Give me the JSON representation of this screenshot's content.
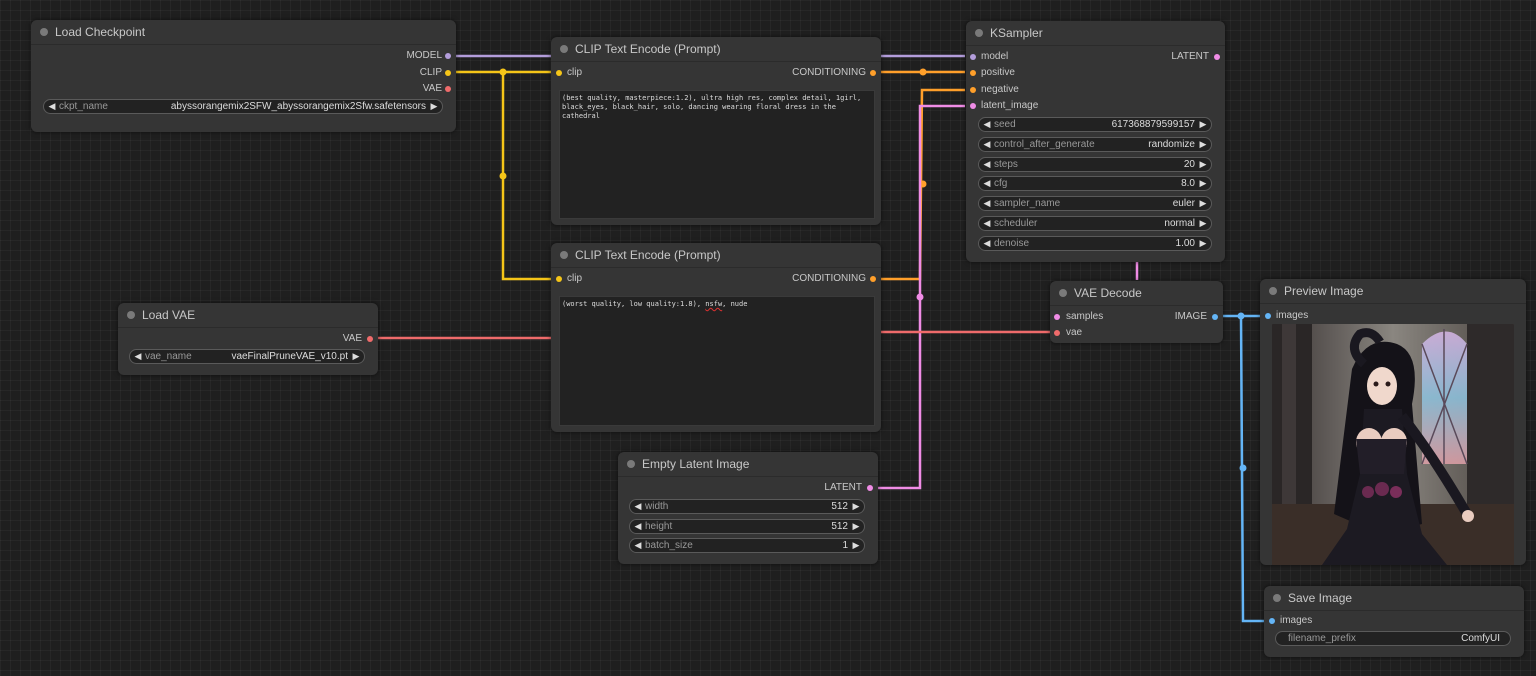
{
  "nodes": {
    "load_checkpoint": {
      "title": "Load Checkpoint",
      "outputs": [
        "MODEL",
        "CLIP",
        "VAE"
      ],
      "widget_label": "ckpt_name",
      "widget_value": "abyssorangemix2SFW_abyssorangemix2Sfw.safetensors"
    },
    "clip_pos": {
      "title": "CLIP Text Encode (Prompt)",
      "input": "clip",
      "output": "CONDITIONING",
      "text": "(best quality, masterpiece:1.2), ultra high res, complex detail, 1girl, black_eyes, black_hair, solo, dancing wearing floral dress in the cathedral"
    },
    "clip_neg": {
      "title": "CLIP Text Encode (Prompt)",
      "input": "clip",
      "output": "CONDITIONING",
      "text_before": "(worst quality, low quality:1.8), ",
      "text_flagged": "nsfw",
      "text_after": ", nude"
    },
    "load_vae": {
      "title": "Load VAE",
      "output": "VAE",
      "widget_label": "vae_name",
      "widget_value": "vaeFinalPruneVAE_v10.pt"
    },
    "empty_latent": {
      "title": "Empty Latent Image",
      "output": "LATENT",
      "widgets": [
        {
          "label": "width",
          "value": "512"
        },
        {
          "label": "height",
          "value": "512"
        },
        {
          "label": "batch_size",
          "value": "1"
        }
      ]
    },
    "ksampler": {
      "title": "KSampler",
      "inputs": [
        "model",
        "positive",
        "negative",
        "latent_image"
      ],
      "output": "LATENT",
      "widgets": [
        {
          "label": "seed",
          "value": "617368879599157"
        },
        {
          "label": "control_after_generate",
          "value": "randomize"
        },
        {
          "label": "steps",
          "value": "20"
        },
        {
          "label": "cfg",
          "value": "8.0"
        },
        {
          "label": "sampler_name",
          "value": "euler"
        },
        {
          "label": "scheduler",
          "value": "normal"
        },
        {
          "label": "denoise",
          "value": "1.00"
        }
      ]
    },
    "vae_decode": {
      "title": "VAE Decode",
      "inputs": [
        "samples",
        "vae"
      ],
      "output": "IMAGE"
    },
    "preview_image": {
      "title": "Preview Image",
      "input": "images"
    },
    "save_image": {
      "title": "Save Image",
      "input": "images",
      "widget_label": "filename_prefix",
      "widget_value": "ComfyUI"
    }
  },
  "colors": {
    "model": "#b39ddb",
    "clip": "#f5c518",
    "vae": "#ef6b6b",
    "conditioning": "#ff9f2a",
    "latent": "#f08ce6",
    "image": "#64b5f6"
  },
  "icons": {
    "widget_left": "left-arrow-icon",
    "widget_right": "right-arrow-icon",
    "node_collapse": "collapse-dot-icon"
  }
}
